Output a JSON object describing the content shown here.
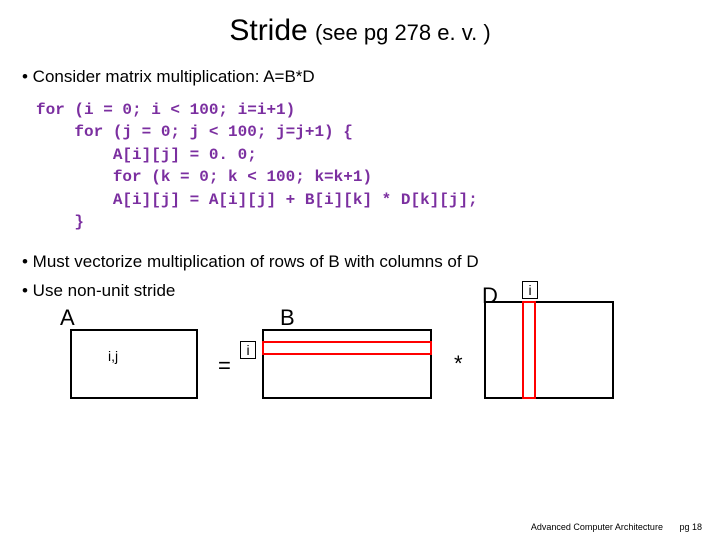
{
  "title": {
    "main": "Stride",
    "sub": "(see pg 278 e. v. )"
  },
  "bullets": {
    "b1": "• Consider  matrix multiplication: A=B*D",
    "b2": "• Must vectorize multiplication of rows of B with columns of D",
    "b3": "• Use non-unit stride"
  },
  "code": "for (i = 0; i < 100; i=i+1)\n    for (j = 0; j < 100; j=j+1) {\n        A[i][j] = 0. 0;\n        for (k = 0; k < 100; k=k+1)\n        A[i][j] = A[i][j] + B[i][k] * D[k][j];\n    }",
  "diagram": {
    "labelA": "A",
    "labelB": "B",
    "labelD": "D",
    "ij": "i,j",
    "i1": "i",
    "i2": "i",
    "eq": "=",
    "mul": "*"
  },
  "footer": {
    "course": "Advanced Computer Architecture",
    "pg": "pg 18"
  }
}
